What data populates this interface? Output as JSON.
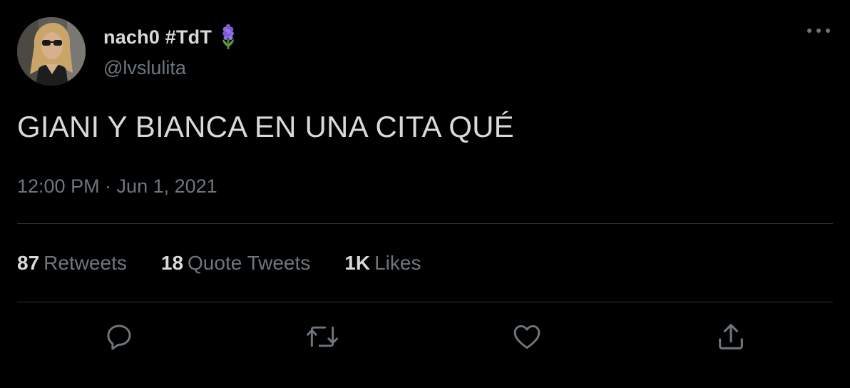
{
  "author": {
    "display_name": "nach0 #TdT",
    "emoji": "hyacinth-emoji",
    "handle": "@lvslulita"
  },
  "tweet": {
    "text": "GIANI Y BIANCA EN UNA CITA QUÉ",
    "timestamp": "12:00 PM · Jun 1, 2021"
  },
  "stats": {
    "retweets_count": "87",
    "retweets_label": "Retweets",
    "quotes_count": "18",
    "quotes_label": "Quote Tweets",
    "likes_count": "1K",
    "likes_label": "Likes"
  },
  "actions": [
    "reply-icon",
    "retweet-icon",
    "like-icon",
    "share-icon"
  ],
  "colors": {
    "background": "#000000",
    "primary_text": "#d9d9d9",
    "secondary_text": "#6e767d",
    "divider": "#2f3336",
    "icon": "#6e767d"
  }
}
